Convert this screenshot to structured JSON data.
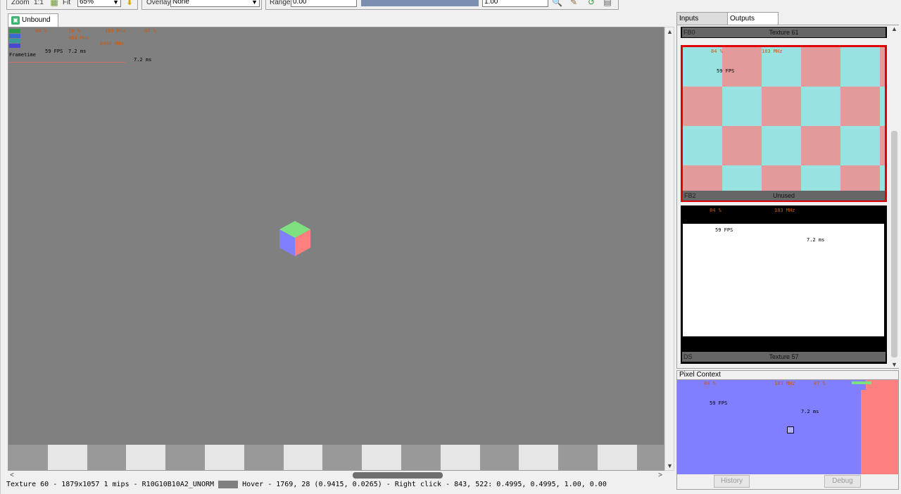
{
  "toolbar": {
    "zoom_label": "Zoom",
    "zoom_ratio": "1:1",
    "fit_label": "Fit",
    "zoom_value": "65%",
    "overlay_label": "Overlay",
    "overlay_value": "None",
    "range_label": "Range",
    "range_min": "0.00",
    "range_max": "1.00"
  },
  "texture_tab": {
    "label": "Unbound",
    "icon": "texture-icon"
  },
  "overlay_stats": {
    "row1": [
      "GPU",
      "84 %",
      "10 %",
      "183 MHz",
      "87 %"
    ],
    "row2": [
      "CPU",
      "30 %",
      "463 MHz"
    ],
    "row3": [
      "RAM",
      "50 %",
      "8400 MHz"
    ],
    "row4": [
      "VRAM",
      "1.2 GB"
    ],
    "fps": "59 FPS",
    "frametime": "7.2 ms",
    "frame_label": "Frametime",
    "graph_time": "7.2 ms"
  },
  "status": {
    "texture_info": "Texture 60 - 1879x1057 1 mips - R10G10B10A2_UNORM",
    "hover_info": "Hover - 1769, 28 (0.9415, 0.0265) - Right click - 843, 522: 0.4995, 0.4995, 1.00, 0.00"
  },
  "right_panel": {
    "tabs": [
      "Inputs",
      "Outputs"
    ],
    "active_tab": "Outputs",
    "thumbnails": [
      {
        "left": "FB0",
        "right": "Texture 61"
      },
      {
        "left": "FB2",
        "right": "Unused"
      },
      {
        "left": "DS",
        "right": "Texture 57"
      }
    ]
  },
  "pixel_context": {
    "title": "Pixel Context",
    "history_label": "History",
    "debug_label": "Debug"
  },
  "colors": {
    "viewport_bg": "#808080",
    "checker_light": "#e6e6e6",
    "checker_dark": "#999999",
    "pink": "#e29a9a",
    "cyan": "#98e2e2",
    "highlight_red": "#e00000",
    "pixel_blue": "#7f7fff",
    "pixel_red": "#ff8080"
  }
}
